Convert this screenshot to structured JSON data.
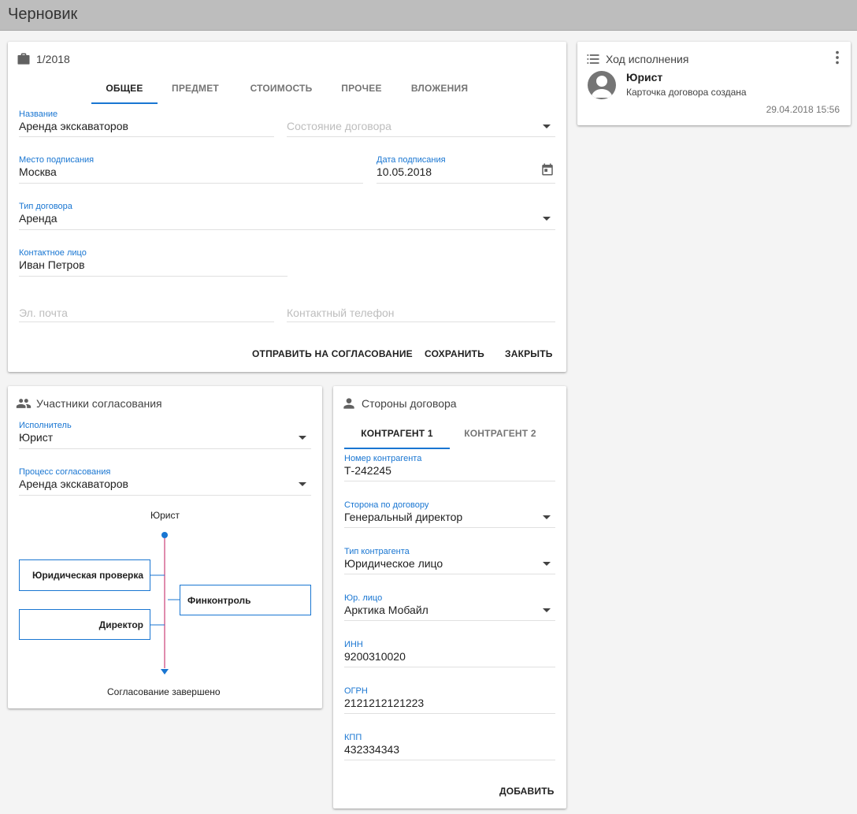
{
  "app": {
    "title": "Черновик"
  },
  "contract_card": {
    "number": "1/2018",
    "tabs": [
      "Общее",
      "Предмет",
      "Стоимость",
      "Прочее",
      "Вложения"
    ],
    "fields": {
      "name": {
        "label": "Название",
        "value": "Аренда экскаваторов"
      },
      "state": {
        "placeholder": "Состояние договора"
      },
      "place": {
        "label": "Место подписания",
        "value": "Москва"
      },
      "date": {
        "label": "Дата подписания",
        "value": "10.05.2018"
      },
      "type": {
        "label": "Тип договора",
        "value": "Аренда"
      },
      "contact": {
        "label": "Контактное лицо",
        "value": "Иван Петров"
      },
      "email": {
        "placeholder": "Эл. почта"
      },
      "phone": {
        "placeholder": "Контактный телефон"
      }
    },
    "actions": {
      "send": "Отправить на согласование",
      "save": "Сохранить",
      "close": "Закрыть"
    }
  },
  "history": {
    "title": "Ход исполнения",
    "entry": {
      "author": "Юрист",
      "text": "Карточка договора создана",
      "timestamp": "29.04.2018 15:56"
    }
  },
  "approvers": {
    "title": "Участники согласования",
    "executor": {
      "label": "Исполнитель",
      "value": "Юрист"
    },
    "process": {
      "label": "Процесс согласования",
      "value": "Аренда экскаваторов"
    },
    "flow": {
      "start": "Юрист",
      "nodes": {
        "legal": "Юридическая проверка",
        "director": "Директор",
        "fincontrol": "Финконтроль"
      },
      "end": "Согласование завершено"
    }
  },
  "parties": {
    "title": "Стороны договора",
    "tabs": [
      "Контрагент 1",
      "Контрагент 2"
    ],
    "fields": {
      "number": {
        "label": "Номер контрагента",
        "value": "Т-242245"
      },
      "side": {
        "label": "Сторона по договору",
        "value": "Генеральный директор"
      },
      "ctype": {
        "label": "Тип контрагента",
        "value": "Юридическое лицо"
      },
      "legal": {
        "label": "Юр. лицо",
        "value": "Арктика Мобайл"
      },
      "inn": {
        "label": "ИНН",
        "value": "9200310020"
      },
      "ogrn": {
        "label": "ОГРН",
        "value": "2121212121223"
      },
      "kpp": {
        "label": "КПП",
        "value": "432334343"
      }
    },
    "add": "Добавить"
  },
  "colors": {
    "accent": "#1976d2",
    "flow_line": "#c2185b",
    "topbar": "#bdbdbd"
  }
}
